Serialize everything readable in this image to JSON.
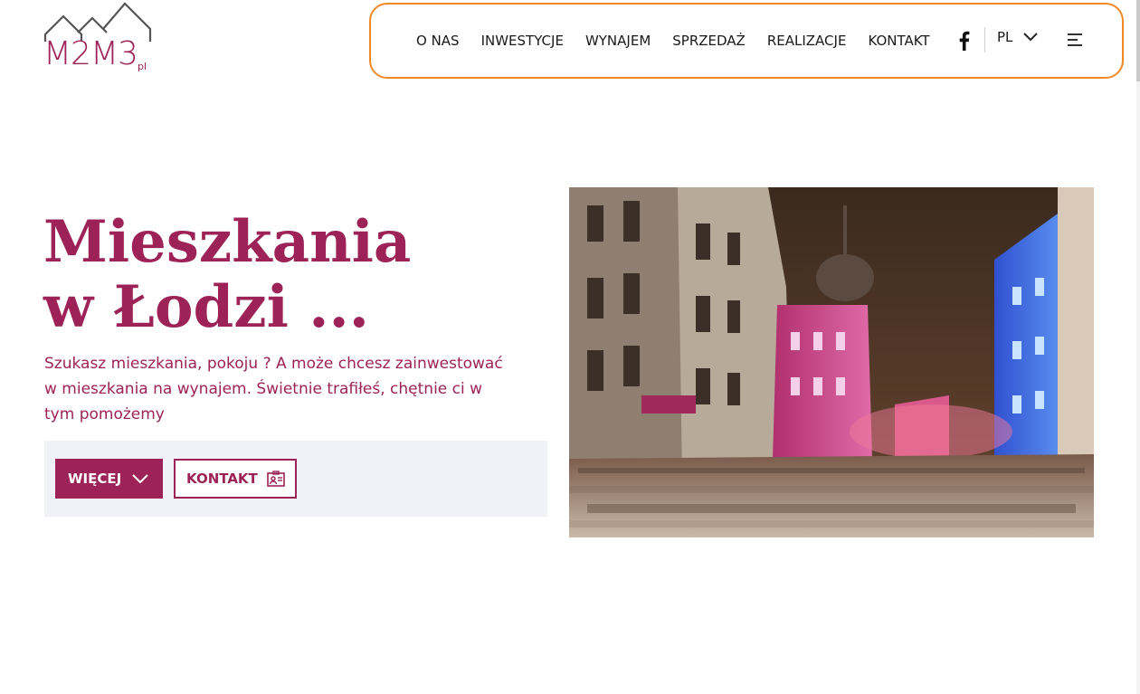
{
  "logo": {
    "main": "M2M3",
    "suffix": "pl",
    "alt": "M2M3.pl logo"
  },
  "nav": {
    "links": [
      "O NAS",
      "INWESTYCJE",
      "WYNAJEM",
      "SPRZEDAŻ",
      "REALIZACJE",
      "KONTAKT"
    ],
    "language": "PL"
  },
  "hero": {
    "title_line1": "Mieszkania",
    "title_line2": "w Łodzi ...",
    "text": "Szukasz mieszkania, pokoju ? A może chcesz zainwestować w mieszkania na wynajem. Świetnie trafiłeś, chętnie ci w tym pomożemy",
    "more_button": "WIĘCEJ",
    "contact_button": "KONTAKT",
    "image_alt": "Ulica Piotrkowska w Łodzi nocą"
  },
  "colors": {
    "brand": "#9c2257",
    "nav_border": "#f08a24",
    "panel": "#f0f2f7"
  },
  "icons": [
    "facebook-icon",
    "chevron-down-icon",
    "menu-icon",
    "contact-card-icon"
  ]
}
